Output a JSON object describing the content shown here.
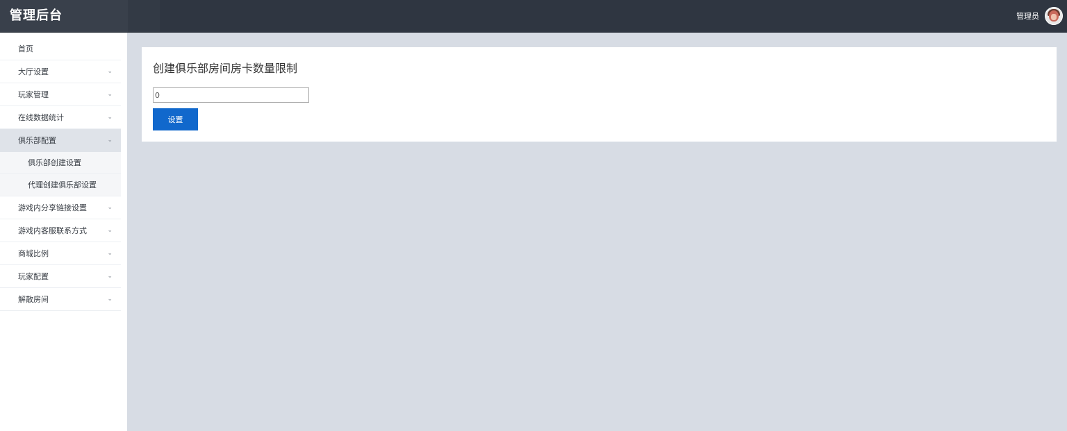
{
  "header": {
    "title": "管理后台",
    "user_name": "管理员",
    "avatar_icon": "user-avatar"
  },
  "sidebar": {
    "home": "首页",
    "items": [
      {
        "label": "大厅设置"
      },
      {
        "label": "玩家管理"
      },
      {
        "label": "在线数据统计"
      },
      {
        "label": "俱乐部配置"
      },
      {
        "label": "游戏内分享链接设置"
      },
      {
        "label": "游戏内客服联系方式"
      },
      {
        "label": "商城比例"
      },
      {
        "label": "玩家配置"
      },
      {
        "label": "解散房间"
      }
    ],
    "active_index": 3,
    "sub_items": [
      {
        "label": "俱乐部创建设置"
      },
      {
        "label": "代理创建俱乐部设置"
      }
    ],
    "chevron": "⌄"
  },
  "main": {
    "title": "创建俱乐部房间房卡数量限制",
    "input_value": "0",
    "submit_label": "设置"
  },
  "colors": {
    "topbar": "#2f3641",
    "brand_bg": "#39404b",
    "page_bg": "#d7dce4",
    "accent": "#1168cc"
  }
}
